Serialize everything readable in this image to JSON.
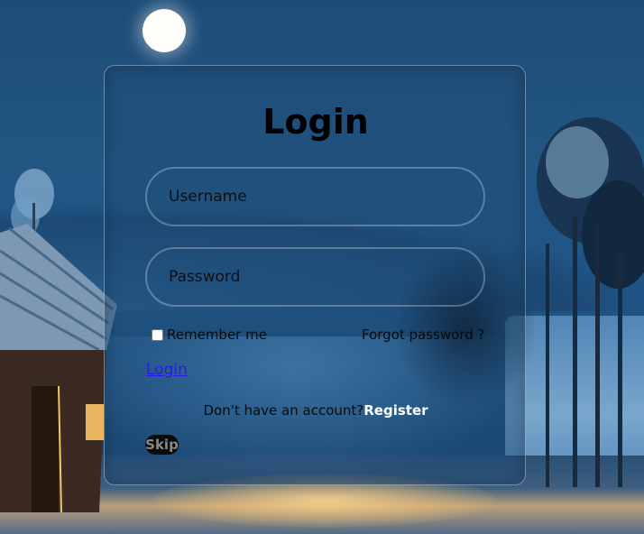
{
  "login": {
    "title": "Login",
    "username_placeholder": "Username",
    "password_placeholder": "Password",
    "remember_label": "Remember me",
    "forgot_label": "Forgot password ?",
    "login_link": "Login",
    "register_prompt": "Don't have an account?",
    "register_link": "Register",
    "skip_label": "Skip"
  },
  "colors": {
    "link": "#2b1aea",
    "register": "#ffffff",
    "title": "#000000"
  }
}
